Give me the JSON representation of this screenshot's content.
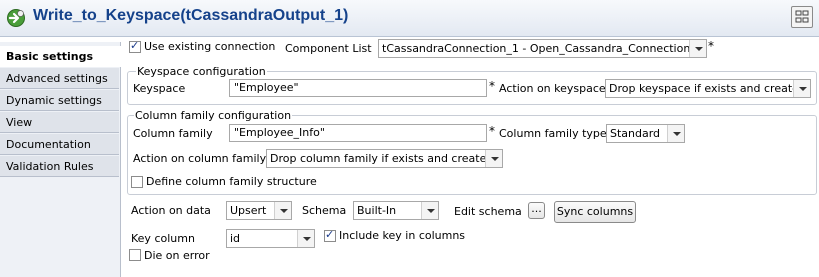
{
  "window": {
    "title": "Write_to_Keyspace(tCassandraOutput_1)",
    "icon": "component-gear-icon",
    "layout_button_icon": "layout-grid-icon"
  },
  "sidebar": {
    "items": [
      {
        "label": "Basic settings",
        "active": true
      },
      {
        "label": "Advanced settings",
        "active": false
      },
      {
        "label": "Dynamic settings",
        "active": false
      },
      {
        "label": "View",
        "active": false
      },
      {
        "label": "Documentation",
        "active": false
      },
      {
        "label": "Validation Rules",
        "active": false
      }
    ]
  },
  "connection": {
    "use_existing_label": "Use existing connection",
    "use_existing_checked": true,
    "component_list_label": "Component List",
    "component_list_value": "tCassandraConnection_1 - Open_Cassandra_Connection",
    "required_mark": "*"
  },
  "keyspace": {
    "group_title": "Keyspace configuration",
    "keyspace_label": "Keyspace",
    "keyspace_value": "\"Employee\"",
    "action_label": "Action on keyspace",
    "action_value": "Drop keyspace if exists and create"
  },
  "column_family": {
    "group_title": "Column family configuration",
    "cf_label": "Column family",
    "cf_value": "\"Employee_Info\"",
    "type_label": "Column family type",
    "type_value": "Standard",
    "action_label": "Action on column family",
    "action_value": "Drop column family if exists and create",
    "define_structure_label": "Define column family structure",
    "define_structure_checked": false
  },
  "data": {
    "action_label": "Action on data",
    "action_value": "Upsert",
    "schema_label": "Schema",
    "schema_value": "Built-In",
    "edit_schema_label": "Edit schema",
    "edit_schema_button": "...",
    "sync_columns_button": "Sync columns",
    "key_column_label": "Key column",
    "key_column_value": "id",
    "include_key_label": "Include key in columns",
    "include_key_checked": true,
    "die_on_error_label": "Die on error",
    "die_on_error_checked": false
  },
  "colors": {
    "title_text": "#15428b",
    "sidebar_bg": "#eef1f6",
    "group_border": "#c8cdd6"
  }
}
